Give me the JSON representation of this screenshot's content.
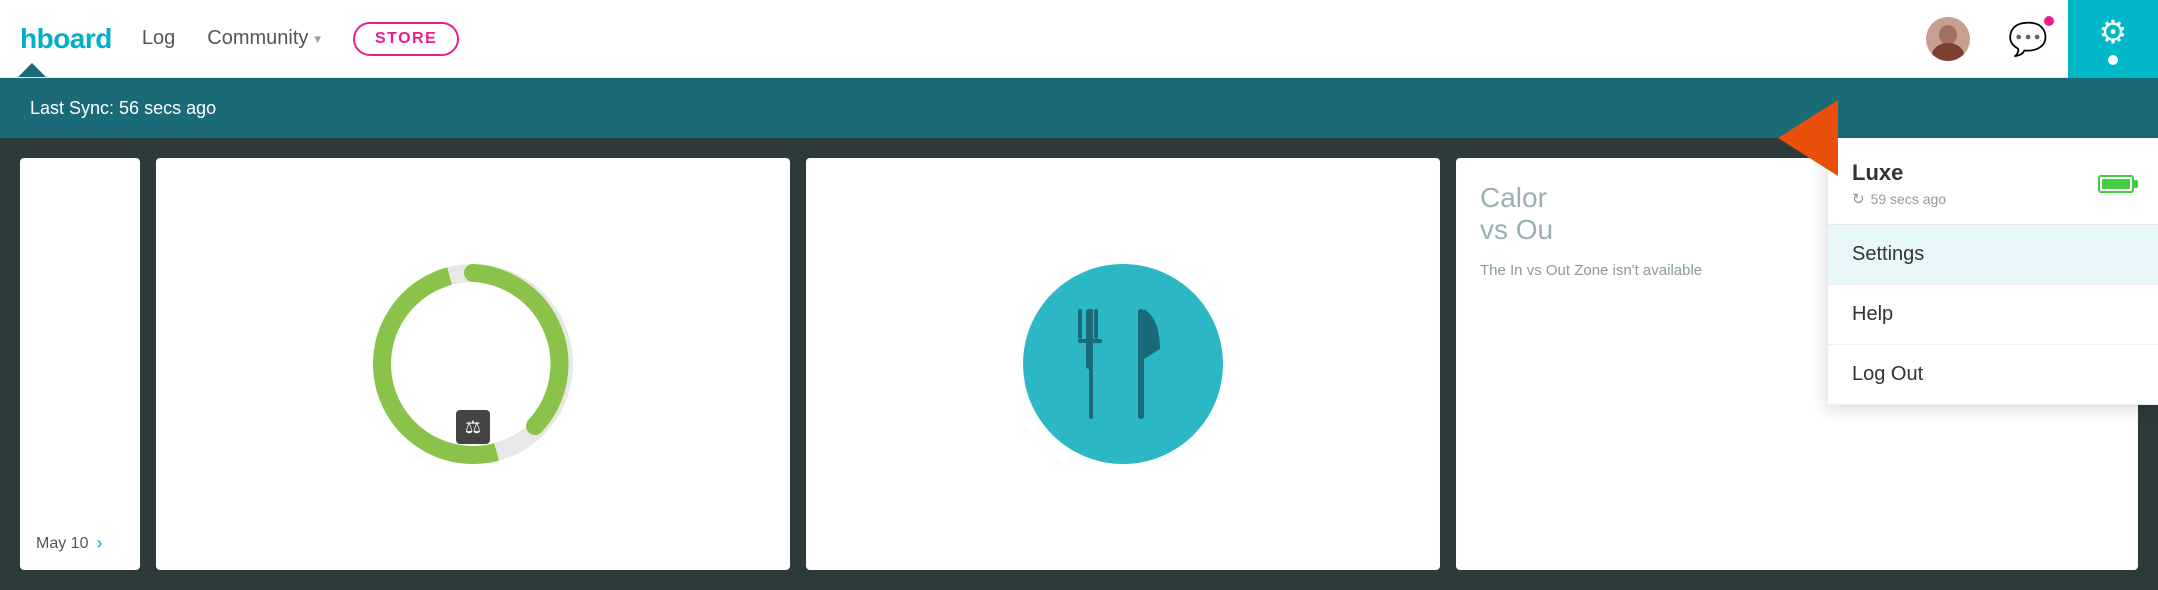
{
  "navbar": {
    "brand": "hboard",
    "links": [
      {
        "id": "dashboard",
        "label": "hboard",
        "active": true
      },
      {
        "id": "log",
        "label": "Log"
      },
      {
        "id": "community",
        "label": "Community"
      },
      {
        "id": "store",
        "label": "STORE"
      }
    ],
    "community_label": "Community",
    "store_label": "STORE",
    "log_label": "Log"
  },
  "banner": {
    "sync_text": "Last Sync: 56 secs ago"
  },
  "dashboard": {
    "date": "May 10",
    "calorie_title_line1": "Calor",
    "calorie_title_line2": "vs Ou",
    "calorie_desc": "The In vs Out Zone isn't available"
  },
  "dropdown": {
    "device_name": "Luxe",
    "sync_time": "59 secs ago",
    "items": [
      {
        "id": "settings",
        "label": "Settings",
        "active": true
      },
      {
        "id": "help",
        "label": "Help"
      },
      {
        "id": "logout",
        "label": "Log Out"
      }
    ]
  },
  "icons": {
    "gear": "⚙",
    "chevron_down": "▾",
    "sync": "↻",
    "fork_knife": "🍴"
  }
}
